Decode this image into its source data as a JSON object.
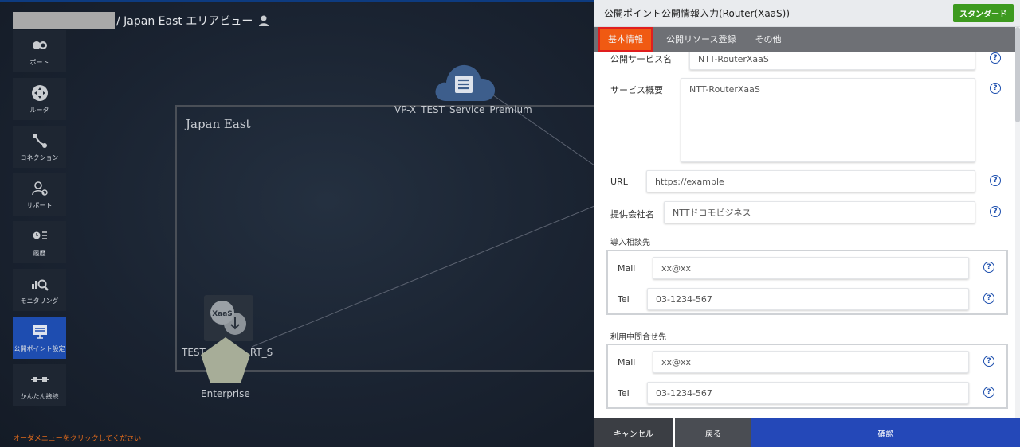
{
  "header": {
    "title": "/ Japan East エリアビュー"
  },
  "sidebar": {
    "items": [
      {
        "label": "ポート",
        "icon": "port-icon"
      },
      {
        "label": "ルータ",
        "icon": "router-icon"
      },
      {
        "label": "コネクション",
        "icon": "connection-icon"
      },
      {
        "label": "サポート",
        "icon": "support-icon"
      },
      {
        "label": "履歴",
        "icon": "history-icon"
      },
      {
        "label": "モニタリング",
        "icon": "monitoring-icon"
      },
      {
        "label": "公開ポイント設定",
        "icon": "public-point-icon"
      },
      {
        "label": "かんたん接続",
        "icon": "easy-connect-icon"
      }
    ],
    "active_index": 6
  },
  "order_hint": "オーダメニューをクリックしてください",
  "canvas": {
    "area_label": "Japan East",
    "cloud_label": "VP-X_TEST_Service_Premium",
    "xaas_badge": "XaaS",
    "xaas_label_left": "TEST",
    "xaas_label_right": "RT_S",
    "enterprise_label": "Enterprise"
  },
  "panel": {
    "title": "公開ポイント公開情報入力(Router(XaaS))",
    "badge": "スタンダード",
    "tabs": [
      "基本情報",
      "公開リソース登録",
      "その他"
    ],
    "active_tab": 0,
    "fields": {
      "service_name_label": "公開サービス名",
      "service_name_value": "NTT-RouterXaaS",
      "service_overview_label": "サービス概要",
      "service_overview_value": "NTT-RouterXaaS",
      "url_label": "URL",
      "url_value": "https://example",
      "provider_label": "提供会社名",
      "provider_value": "NTTドコモビジネス"
    },
    "intro_contact": {
      "title": "導入相談先",
      "mail_label": "Mail",
      "mail_value": "xx@xx",
      "tel_label": "Tel",
      "tel_value": "03-1234-567"
    },
    "usage_contact": {
      "title": "利用中問合せ先",
      "mail_label": "Mail",
      "mail_value": "xx@xx",
      "tel_label": "Tel",
      "tel_value": "03-1234-567"
    },
    "help_glyph": "?",
    "footer": {
      "cancel": "キャンセル",
      "back": "戻る",
      "confirm": "確認"
    }
  },
  "colors": {
    "accent_blue": "#2448b8",
    "active_tab": "#f05a12",
    "badge_green": "#3d9a1f",
    "hint_orange": "#e06a1c"
  }
}
